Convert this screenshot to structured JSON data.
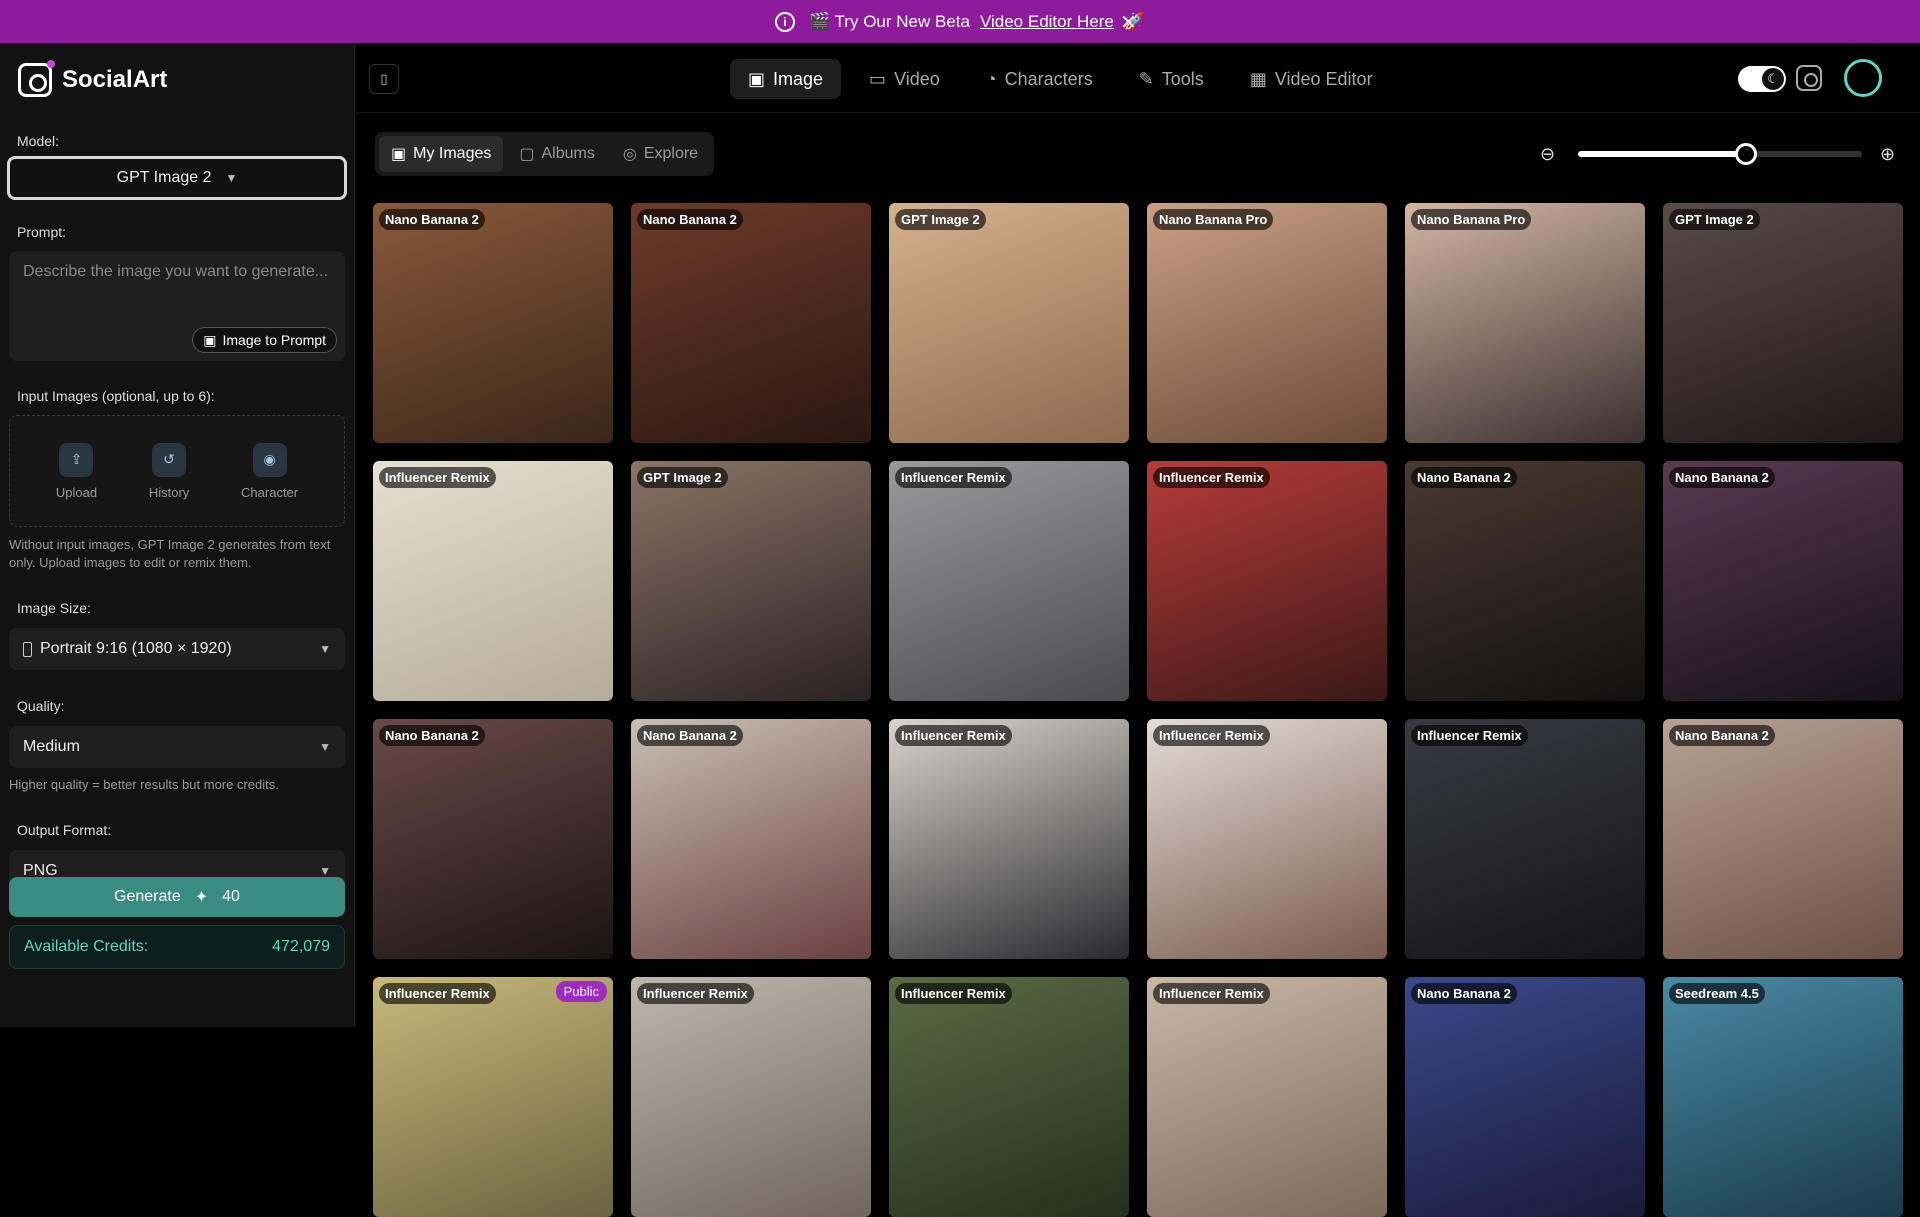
{
  "banner": {
    "text": "🎬 Try Our New Beta ",
    "link": "Video Editor Here",
    "emoji": " 🚀",
    "close": "✕"
  },
  "brand": {
    "name": "SocialArt"
  },
  "sidebar": {
    "model_label": "Model:",
    "model_value": "GPT Image 2",
    "prompt_label": "Prompt:",
    "prompt_placeholder": "Describe the image you want to generate...",
    "image_to_prompt": "Image to Prompt",
    "input_images_label": "Input Images (optional, up to 6):",
    "input_slots": [
      {
        "label": "Upload",
        "icon": "upload-icon"
      },
      {
        "label": "History",
        "icon": "history-icon"
      },
      {
        "label": "Character",
        "icon": "character-icon"
      }
    ],
    "input_hint": "Without input images, GPT Image 2 generates from text only. Upload images to edit or remix them.",
    "size_label": "Image Size:",
    "size_value": "Portrait 9:16 (1080 × 1920)",
    "quality_label": "Quality:",
    "quality_value": "Medium",
    "quality_hint": "Higher quality = better results but more credits.",
    "format_label": "Output Format:",
    "format_value": "PNG",
    "generate_label": "Generate",
    "generate_cost": "40",
    "credits_label": "Available Credits:",
    "credits_value": "472,079"
  },
  "nav": {
    "tabs": [
      {
        "label": "Image",
        "icon": "image-icon",
        "active": true
      },
      {
        "label": "Video",
        "icon": "video-icon",
        "active": false
      },
      {
        "label": "Characters",
        "icon": "person-icon",
        "active": false
      },
      {
        "label": "Tools",
        "icon": "wrench-icon",
        "active": false
      },
      {
        "label": "Video Editor",
        "icon": "film-icon",
        "active": false
      }
    ]
  },
  "subtabs": [
    {
      "label": "My Images",
      "icon": "image-icon",
      "active": true
    },
    {
      "label": "Albums",
      "icon": "folder-icon",
      "active": false
    },
    {
      "label": "Explore",
      "icon": "compass-icon",
      "active": false
    }
  ],
  "zoom": {
    "level": 0.59
  },
  "gallery": [
    {
      "tag": "Nano Banana 2",
      "colors": [
        "#8a5a3a",
        "#3a2618"
      ]
    },
    {
      "tag": "Nano Banana 2",
      "colors": [
        "#6e3b2a",
        "#2a1712"
      ]
    },
    {
      "tag": "GPT Image 2",
      "colors": [
        "#d6b08e",
        "#8d6a4e"
      ]
    },
    {
      "tag": "Nano Banana Pro",
      "colors": [
        "#c9a084",
        "#6b4a38"
      ]
    },
    {
      "tag": "Nano Banana Pro",
      "colors": [
        "#d2b6a2",
        "#3a3030"
      ]
    },
    {
      "tag": "GPT Image 2",
      "colors": [
        "#5a4a4a",
        "#1f1717"
      ]
    },
    {
      "tag": "Influencer Remix",
      "colors": [
        "#e6e0d2",
        "#b4ab98"
      ]
    },
    {
      "tag": "GPT Image 2",
      "colors": [
        "#8a7466",
        "#2a2222"
      ]
    },
    {
      "tag": "Influencer Remix",
      "colors": [
        "#9a9a9c",
        "#4b4b4e"
      ]
    },
    {
      "tag": "Influencer Remix",
      "colors": [
        "#b83c38",
        "#3a1818"
      ]
    },
    {
      "tag": "Nano Banana 2",
      "colors": [
        "#4a3a30",
        "#121010"
      ]
    },
    {
      "tag": "Nano Banana 2",
      "colors": [
        "#5a3a50",
        "#15101a"
      ]
    },
    {
      "tag": "Nano Banana 2",
      "colors": [
        "#6a4a46",
        "#1a1414"
      ]
    },
    {
      "tag": "Nano Banana 2",
      "colors": [
        "#c8bfb2",
        "#6a4040"
      ]
    },
    {
      "tag": "Influencer Remix",
      "colors": [
        "#d8d4ce",
        "#2a2a2e"
      ]
    },
    {
      "tag": "Influencer Remix",
      "colors": [
        "#e2ddd6",
        "#7a5a4e"
      ]
    },
    {
      "tag": "Influencer Remix",
      "colors": [
        "#3a3a44",
        "#141416"
      ]
    },
    {
      "tag": "Nano Banana 2",
      "colors": [
        "#b8a294",
        "#6a5044"
      ]
    },
    {
      "tag": "Influencer Remix",
      "badge": "Public",
      "colors": [
        "#c8b87a",
        "#6a6440"
      ]
    },
    {
      "tag": "Influencer Remix",
      "colors": [
        "#bfb7ac",
        "#6f665e"
      ]
    },
    {
      "tag": "Influencer Remix",
      "colors": [
        "#5a6a44",
        "#24301c"
      ]
    },
    {
      "tag": "Influencer Remix",
      "colors": [
        "#c8b8a4",
        "#7a6a5a"
      ]
    },
    {
      "tag": "Nano Banana 2",
      "colors": [
        "#3a4a8a",
        "#1a1a3a"
      ]
    },
    {
      "tag": "Seedream 4.5",
      "colors": [
        "#4a8aa4",
        "#1a3a4a"
      ]
    }
  ]
}
